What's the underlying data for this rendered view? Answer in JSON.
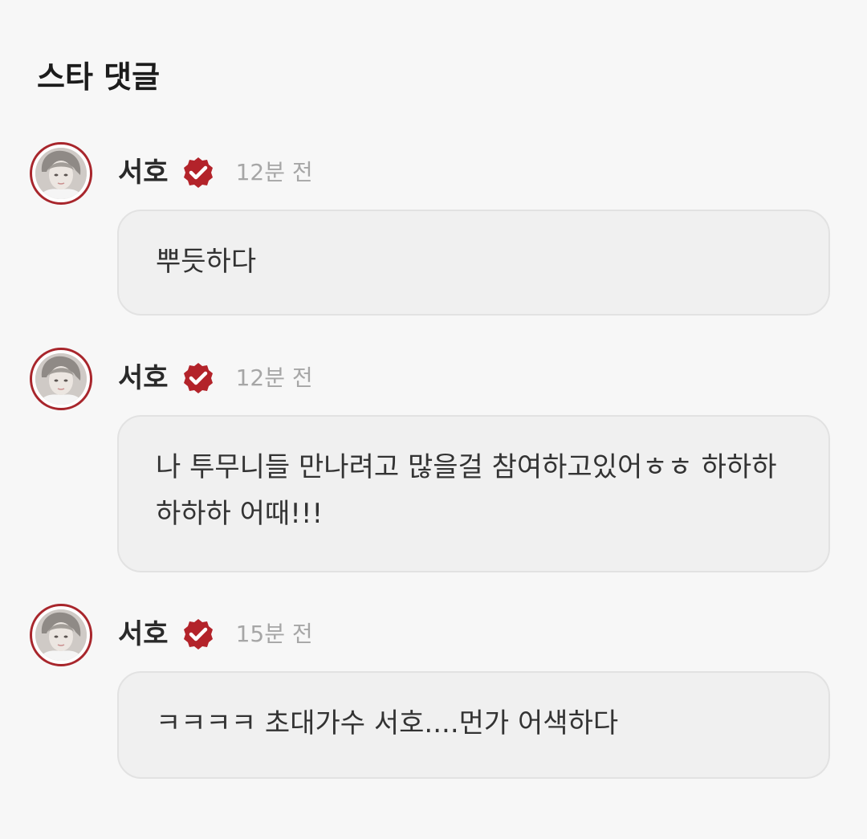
{
  "section": {
    "title": "스타 댓글"
  },
  "colors": {
    "accent": "#a8262c",
    "background": "#f7f7f7",
    "bubble": "#f0f0f0",
    "timestamp": "#a6a6a6"
  },
  "comments": [
    {
      "author": "서호",
      "verified_icon": "verified-badge-icon",
      "time": "12분 전",
      "text": "뿌듯하다"
    },
    {
      "author": "서호",
      "verified_icon": "verified-badge-icon",
      "time": "12분 전",
      "text": "나 투무니들 만나려고 많을걸 참여하고있어ㅎㅎ 하하하하하하 어때!!!"
    },
    {
      "author": "서호",
      "verified_icon": "verified-badge-icon",
      "time": "15분 전",
      "text": "ㅋㅋㅋㅋ 초대가수 서호....먼가 어색하다"
    }
  ]
}
